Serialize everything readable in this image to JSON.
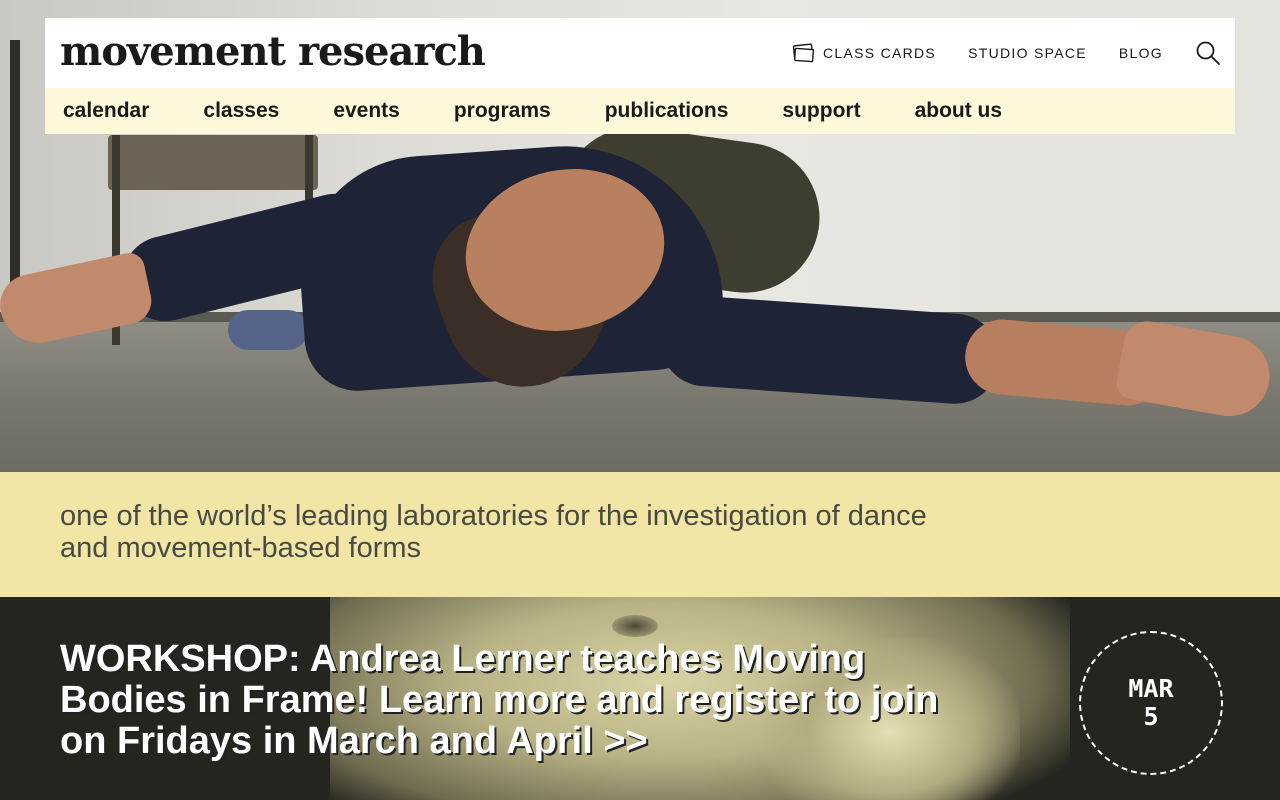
{
  "header": {
    "logo_text": "movement research",
    "utility_links": {
      "class_cards": "CLASS CARDS",
      "studio_space": "STUDIO SPACE",
      "blog": "BLOG"
    }
  },
  "main_nav": {
    "calendar": "calendar",
    "classes": "classes",
    "events": "events",
    "programs": "programs",
    "publications": "publications",
    "support": "support",
    "about_us": "about us"
  },
  "tagline": "one of the world’s leading laboratories for the investigation of dance and movement-based forms",
  "promo": {
    "headline": "WORKSHOP: Andrea Lerner teaches Moving Bodies in Frame! Learn more and register to join on Fridays in March and April >>",
    "date_month": "MAR",
    "date_day": "5"
  },
  "colors": {
    "nav_bottom_bg": "#fdf9da",
    "tagline_bg": "#f2e6a6",
    "promo_bg": "#25251f"
  },
  "icons": [
    "class-cards-icon",
    "search-icon"
  ]
}
